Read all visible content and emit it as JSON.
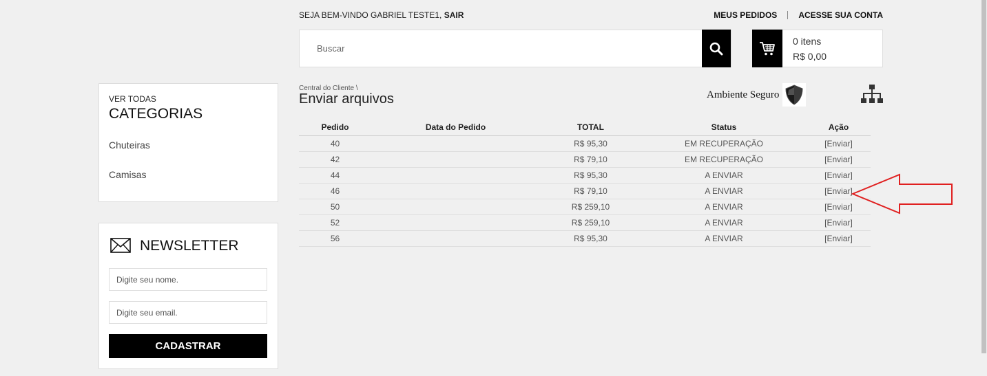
{
  "header": {
    "welcome_prefix": "SEJA BEM-VINDO GABRIEL TESTE1, ",
    "logout": "SAIR",
    "my_orders": "MEUS PEDIDOS",
    "account": "ACESSE SUA CONTA"
  },
  "search": {
    "placeholder": "Buscar",
    "icon": "search-icon"
  },
  "cart": {
    "items": "0 itens",
    "total": "R$ 0,00",
    "icon": "cart-icon"
  },
  "categories": {
    "small_label": "VER TODAS",
    "title": "CATEGORIAS",
    "items": [
      {
        "label": "Chuteiras"
      },
      {
        "label": "Camisas"
      }
    ]
  },
  "newsletter": {
    "title": "NEWSLETTER",
    "name_placeholder": "Digite seu nome.",
    "email_placeholder": "Digite seu email.",
    "submit": "CADASTRAR",
    "icon": "envelope-icon"
  },
  "main": {
    "breadcrumb": "Central do Cliente \\",
    "title": "Enviar arquivos",
    "secure_label": "Ambiente Seguro",
    "secure_icon": "shield-icon",
    "sitemap_icon": "sitemap-icon"
  },
  "orders_table": {
    "columns": [
      "Pedido",
      "Data do Pedido",
      "TOTAL",
      "Status",
      "Ação"
    ],
    "rows": [
      {
        "pedido": "40",
        "data": "",
        "total": "R$ 95,30",
        "status": "EM RECUPERAÇÃO",
        "acao": "[Enviar]"
      },
      {
        "pedido": "42",
        "data": "",
        "total": "R$ 79,10",
        "status": "EM RECUPERAÇÃO",
        "acao": "[Enviar]"
      },
      {
        "pedido": "44",
        "data": "",
        "total": "R$ 95,30",
        "status": "A ENVIAR",
        "acao": "[Enviar]"
      },
      {
        "pedido": "46",
        "data": "",
        "total": "R$ 79,10",
        "status": "A ENVIAR",
        "acao": "[Enviar]"
      },
      {
        "pedido": "50",
        "data": "",
        "total": "R$ 259,10",
        "status": "A ENVIAR",
        "acao": "[Enviar]"
      },
      {
        "pedido": "52",
        "data": "",
        "total": "R$ 259,10",
        "status": "A ENVIAR",
        "acao": "[Enviar]"
      },
      {
        "pedido": "56",
        "data": "",
        "total": "R$ 95,30",
        "status": "A ENVIAR",
        "acao": "[Enviar]"
      }
    ]
  },
  "colors": {
    "accent": "#000000",
    "annotation": "#e02020",
    "background": "#f0f0f0"
  }
}
